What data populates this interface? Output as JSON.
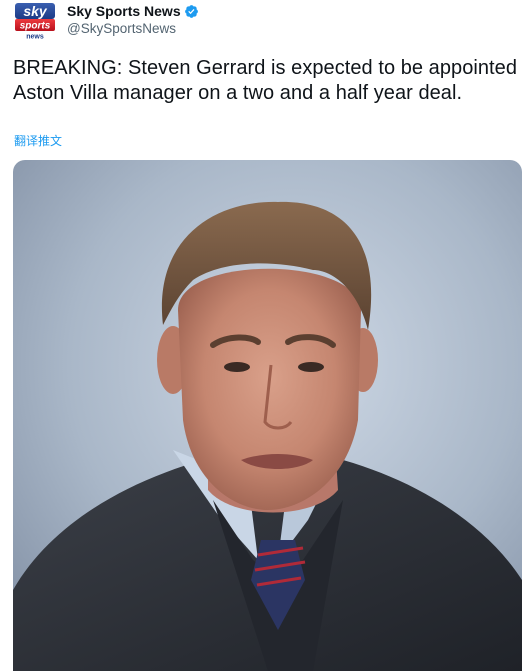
{
  "author": {
    "display_name": "Sky Sports News",
    "handle": "@SkySportsNews",
    "verified": true,
    "avatar": {
      "icon": "sky-sports-news-logo-icon",
      "logo_text_top": "sky",
      "logo_text_middle": "sports",
      "logo_text_bottom": "news"
    }
  },
  "tweet": {
    "text": "BREAKING: Steven Gerrard is expected to be appointed Aston Villa manager on a two and a half year deal.",
    "translate_label": "翻译推文"
  },
  "media": {
    "type": "photo",
    "subject": "man-portrait-photo"
  },
  "colors": {
    "link_blue": "#1d9bf0",
    "verified_blue": "#1d9bf0",
    "text_primary": "#0f1419",
    "text_secondary": "#536471",
    "sky_red": "#d4182a"
  }
}
